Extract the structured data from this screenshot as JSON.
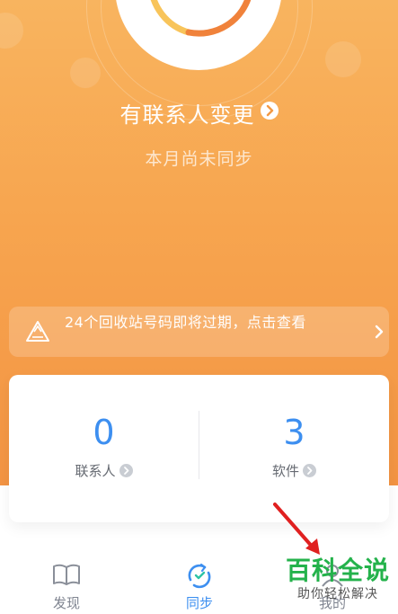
{
  "header": {
    "status_title": "有联系人变更",
    "status_subtitle": "本月尚未同步"
  },
  "notice": {
    "text": "24个回收站号码即将过期，点击查看"
  },
  "stats": [
    {
      "value": "0",
      "label": "联系人"
    },
    {
      "value": "3",
      "label": "软件"
    }
  ],
  "bottom_nav": [
    {
      "label": "发现",
      "icon": "book-icon",
      "active": false
    },
    {
      "label": "同步",
      "icon": "sync-icon",
      "active": true
    },
    {
      "label": "我的",
      "icon": "person-icon",
      "active": false
    }
  ],
  "watermark": {
    "title": "百科全说",
    "subtitle": "助你轻松解决"
  },
  "colors": {
    "accent_blue": "#3d8ff0",
    "hero_orange": "#f7a54f",
    "annotation_red": "#e02020",
    "watermark_green": "#24b24b"
  }
}
